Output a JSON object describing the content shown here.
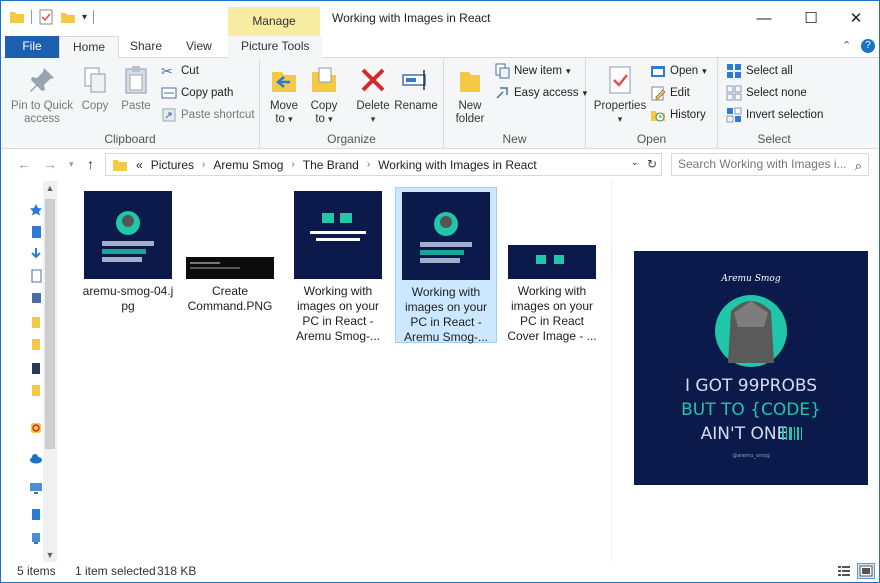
{
  "window": {
    "title": "Working with Images in React",
    "context_tab": "Manage",
    "min_glyph": "—",
    "max_glyph": "☐",
    "close_glyph": "✕"
  },
  "ribbon_tabs": {
    "file": "File",
    "home": "Home",
    "share": "Share",
    "view": "View",
    "picture_tools": "Picture Tools"
  },
  "clipboard": {
    "label": "Clipboard",
    "pin": "Pin to Quick access",
    "copy": "Copy",
    "paste": "Paste",
    "cut": "Cut",
    "copy_path": "Copy path",
    "paste_shortcut": "Paste shortcut"
  },
  "organize": {
    "label": "Organize",
    "move_to": "Move to",
    "copy_to": "Copy to",
    "delete": "Delete",
    "rename": "Rename"
  },
  "new": {
    "label": "New",
    "new_folder": "New folder",
    "new_item": "New item",
    "easy_access": "Easy access"
  },
  "open": {
    "label": "Open",
    "properties": "Properties",
    "open": "Open",
    "edit": "Edit",
    "history": "History"
  },
  "select": {
    "label": "Select",
    "select_all": "Select all",
    "select_none": "Select none",
    "invert": "Invert selection"
  },
  "address": {
    "overflow": "«",
    "crumbs": [
      "Pictures",
      "Aremu Smog",
      "The Brand",
      "Working with Images in React"
    ],
    "search_placeholder": "Search Working with Images i..."
  },
  "files": [
    {
      "name": "aremu-smog-04.jpg",
      "display": "aremu-smog-04.j pg",
      "selected": false
    },
    {
      "name": "Create Command.PNG",
      "display": "Create Command.PNG",
      "selected": false
    },
    {
      "name": "Working with images on your PC in React - Aremu Smog-...",
      "display": "Working with images on your PC in React - Aremu Smog-...",
      "selected": false
    },
    {
      "name": "Working with images on your PC in React - Aremu Smog-...",
      "display": "Working with images on your PC in React - Aremu Smog-...",
      "selected": true
    },
    {
      "name": "Working with images on your PC in React Cover Image - ...",
      "display": "Working with images on your PC in React Cover Image - ...",
      "selected": false
    }
  ],
  "thumb_text": {
    "brand": "Aremu Smog",
    "line1": "I GOT 99PROBS",
    "line2": "BUT TO {CODE}",
    "line3": "AIN'T ONE",
    "handle": "@aremu_smog",
    "cover_title": "Working with images on your PC in React"
  },
  "status": {
    "count": "5 items",
    "selection": "1 item selected",
    "size": "318 KB"
  },
  "colors": {
    "navy": "#0b1a4a",
    "teal": "#1fc6a8",
    "selection": "#cce8ff",
    "file_tab": "#1c5fb0",
    "manage_tab": "#f8eca0"
  }
}
